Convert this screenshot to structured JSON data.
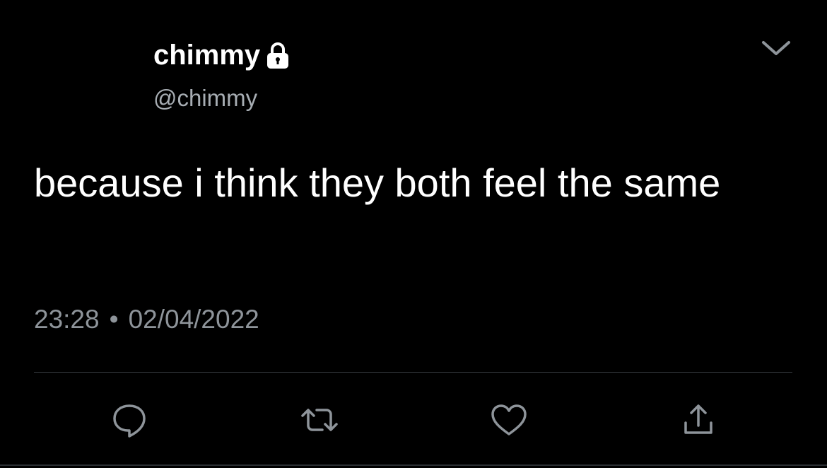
{
  "tweet": {
    "display_name": "chimmy",
    "handle": "@chimmy",
    "verified_icon": "lock-icon",
    "text": "because i think they both feel the same",
    "time": "23:28",
    "separator": "•",
    "date": "02/04/2022"
  },
  "actions": [
    {
      "name": "reply",
      "icon": "speech-bubble-icon"
    },
    {
      "name": "retweet",
      "icon": "retweet-arrows-icon"
    },
    {
      "name": "like",
      "icon": "heart-icon"
    },
    {
      "name": "share",
      "icon": "share-upload-icon"
    }
  ],
  "colors": {
    "background": "#000000",
    "text_primary": "#ffffff",
    "text_secondary": "#8e949a",
    "divider": "#3a3f44",
    "icon": "#8e949a"
  }
}
